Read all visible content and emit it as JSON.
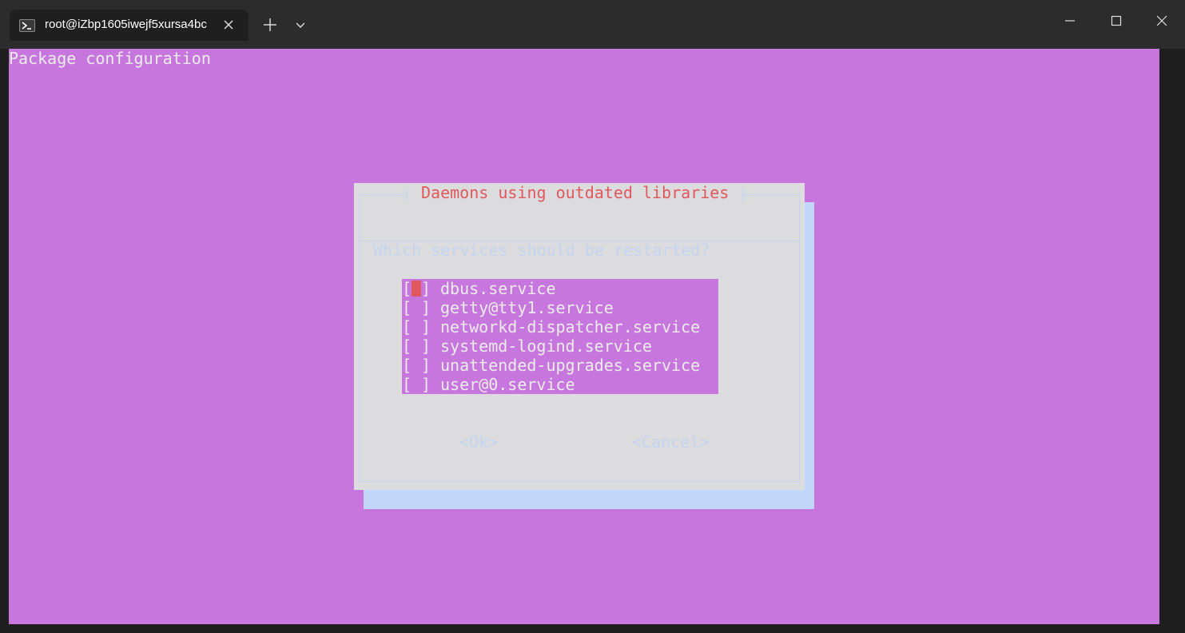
{
  "window": {
    "tab_title": "root@iZbp1605iwejf5xursa4bc",
    "icons": {
      "tab": "powershell-icon",
      "close_tab": "close-icon",
      "new_tab": "plus-icon",
      "dropdown": "chevron-down-icon",
      "minimize": "minimize-icon",
      "maximize": "maximize-icon",
      "close": "close-icon"
    }
  },
  "terminal": {
    "heading": "Package configuration",
    "background": "#c776dd",
    "dialog": {
      "title": "Daemons using outdated libraries",
      "question": "Which services should be restarted?",
      "services": [
        {
          "name": "dbus.service",
          "checked": false,
          "focused": true
        },
        {
          "name": "getty@tty1.service",
          "checked": false,
          "focused": false
        },
        {
          "name": "networkd-dispatcher.service",
          "checked": false,
          "focused": false
        },
        {
          "name": "systemd-logind.service",
          "checked": false,
          "focused": false
        },
        {
          "name": "unattended-upgrades.service",
          "checked": false,
          "focused": false
        },
        {
          "name": "user@0.service",
          "checked": false,
          "focused": false
        }
      ],
      "ok_label": "<Ok>",
      "cancel_label": "<Cancel>",
      "colors": {
        "title": "#e0585d",
        "dialog_bg": "#dcdcdf",
        "shadow": "#c2d6fa",
        "list_bg": "#c776dd",
        "cursor": "#e0585d"
      }
    }
  }
}
